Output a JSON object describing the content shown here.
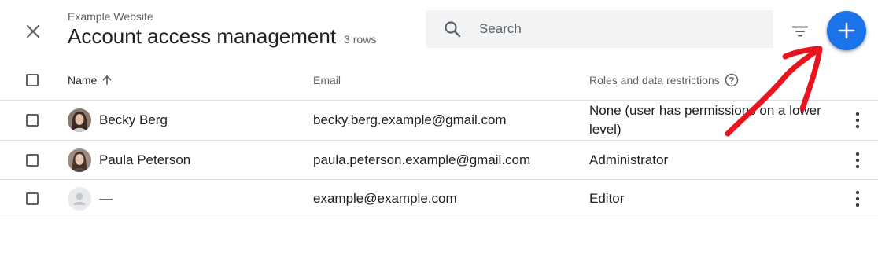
{
  "header": {
    "site_name": "Example Website",
    "title": "Account access management",
    "row_count": "3 rows",
    "search_placeholder": "Search"
  },
  "columns": {
    "name": "Name",
    "email": "Email",
    "roles": "Roles and data restrictions"
  },
  "users": [
    {
      "name": "Becky Berg",
      "email": "becky.berg.example@gmail.com",
      "role": "None (user has permissions on a lower level)"
    },
    {
      "name": "Paula Peterson",
      "email": "paula.peterson.example@gmail.com",
      "role": "Administrator"
    },
    {
      "name": "—",
      "email": "example@example.com",
      "role": "Editor"
    }
  ],
  "colors": {
    "accent": "#1a73e8",
    "annotation": "#e8141e"
  }
}
